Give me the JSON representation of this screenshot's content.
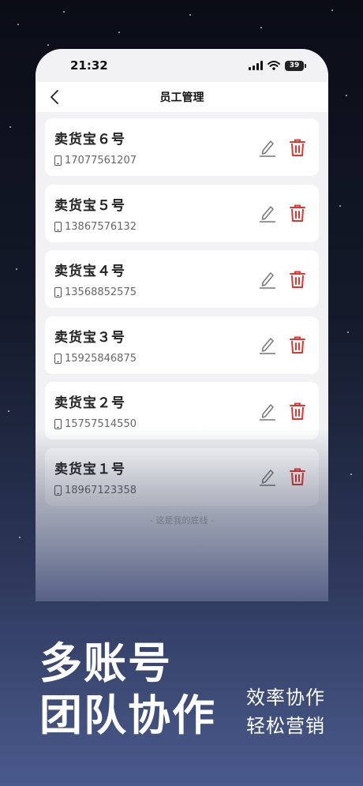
{
  "status_bar": {
    "time": "21:32",
    "battery": "39"
  },
  "nav": {
    "title": "员工管理"
  },
  "employees": [
    {
      "name": "卖货宝６号",
      "phone": "17077561207"
    },
    {
      "name": "卖货宝５号",
      "phone": "13867576132"
    },
    {
      "name": "卖货宝４号",
      "phone": "13568852575"
    },
    {
      "name": "卖货宝３号",
      "phone": "15925846875"
    },
    {
      "name": "卖货宝２号",
      "phone": "15757514550"
    },
    {
      "name": "卖货宝１号",
      "phone": "18967123358"
    }
  ],
  "footer": {
    "end_text": "- 这是我的底线 -"
  },
  "promo": {
    "headline_line1": "多账号",
    "headline_line2": "团队协作",
    "sub_line1": "效率协作",
    "sub_line2": "轻松营销"
  },
  "colors": {
    "accent_delete": "#e0342d",
    "edit_gray": "#777777",
    "bg_dark": "#141a2a"
  }
}
